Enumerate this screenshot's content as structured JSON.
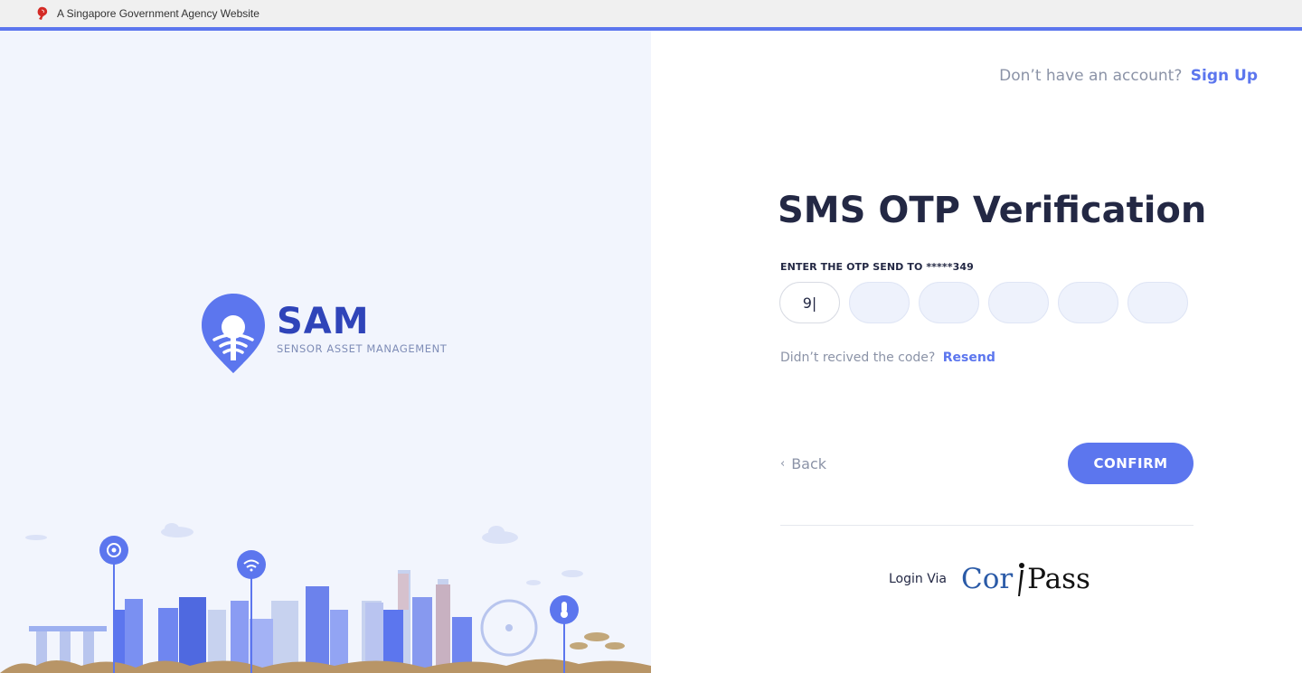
{
  "gov_banner": {
    "text": "A Singapore Government Agency Website",
    "icon": "lion-head-icon"
  },
  "brand": {
    "title": "SAM",
    "subtitle": "SENSOR ASSET MANAGEMENT"
  },
  "header": {
    "signup_question": "Don’t have an account?",
    "signup_link": "Sign Up"
  },
  "otp": {
    "title": "SMS OTP Verification",
    "label": "ENTER THE OTP SEND TO *****349",
    "digits": [
      "9|",
      "",
      "",
      "",
      "",
      ""
    ],
    "resend_question": "Didn’t recived the code?",
    "resend_link": "Resend"
  },
  "actions": {
    "back_label": "Back",
    "confirm_label": "CONFIRM"
  },
  "footer": {
    "login_via": "Login Via",
    "corppass_cor": "Cor",
    "corppass_pass": "Pass"
  },
  "colors": {
    "accent": "#5c76ee",
    "brand_dark": "#2f44b9",
    "title_dark": "#232844",
    "muted": "#8b93a7",
    "left_bg": "#f2f5fd"
  }
}
